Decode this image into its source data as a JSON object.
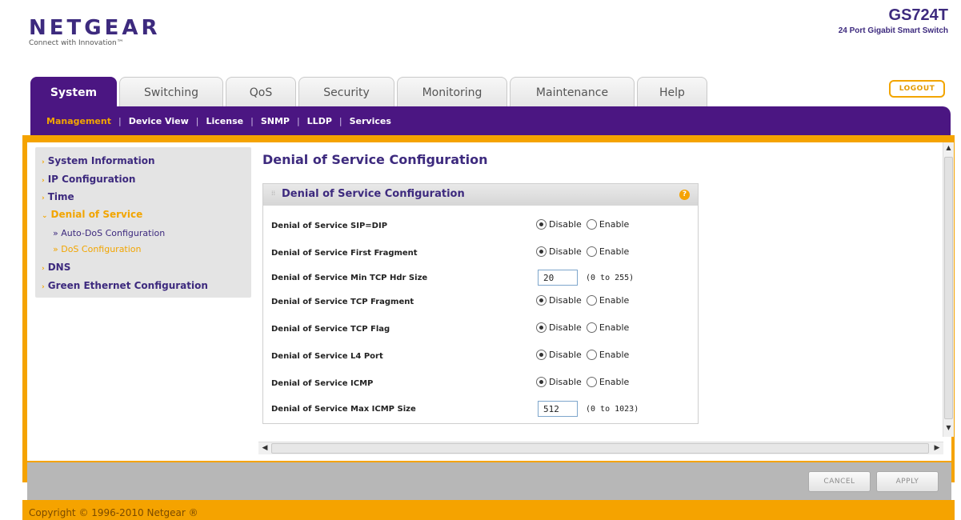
{
  "header": {
    "logo": "NETGEAR",
    "logo_tagline": "Connect with Innovation™",
    "model": "GS724T",
    "model_desc": "24 Port Gigabit Smart Switch",
    "logout_label": "LOGOUT"
  },
  "tabs": [
    {
      "label": "System"
    },
    {
      "label": "Switching"
    },
    {
      "label": "QoS"
    },
    {
      "label": "Security"
    },
    {
      "label": "Monitoring"
    },
    {
      "label": "Maintenance"
    },
    {
      "label": "Help"
    }
  ],
  "subnav": {
    "items": [
      {
        "label": "Management"
      },
      {
        "label": "Device View"
      },
      {
        "label": "License"
      },
      {
        "label": "SNMP"
      },
      {
        "label": "LLDP"
      },
      {
        "label": "Services"
      }
    ]
  },
  "sidebar": {
    "items": [
      {
        "label": "System Information"
      },
      {
        "label": "IP Configuration"
      },
      {
        "label": "Time"
      },
      {
        "label": "Denial of Service"
      },
      {
        "label": "DNS"
      },
      {
        "label": "Green Ethernet Configuration"
      }
    ],
    "subitems": [
      {
        "label": "» Auto-DoS Configuration"
      },
      {
        "label": "» DoS Configuration"
      }
    ]
  },
  "main": {
    "page_title": "Denial of Service Configuration",
    "panel_title": "Denial of Service Configuration",
    "disable_label": "Disable",
    "enable_label": "Enable",
    "rows": [
      {
        "label": "Denial of Service SIP=DIP"
      },
      {
        "label": "Denial of Service First Fragment"
      },
      {
        "label": "Denial of Service Min TCP Hdr Size",
        "value": "20",
        "range": "(0 to 255)"
      },
      {
        "label": "Denial of Service TCP Fragment"
      },
      {
        "label": "Denial of Service TCP Flag"
      },
      {
        "label": "Denial of Service L4 Port"
      },
      {
        "label": "Denial of Service ICMP"
      },
      {
        "label": "Denial of Service Max ICMP Size",
        "value": "512",
        "range": "(0 to 1023)"
      }
    ]
  },
  "footer": {
    "cancel_label": "CANCEL",
    "apply_label": "APPLY",
    "copyright": "Copyright © 1996-2010 Netgear ®"
  },
  "colors": {
    "brand_purple": "#4b1682",
    "accent_orange": "#f5a300"
  }
}
